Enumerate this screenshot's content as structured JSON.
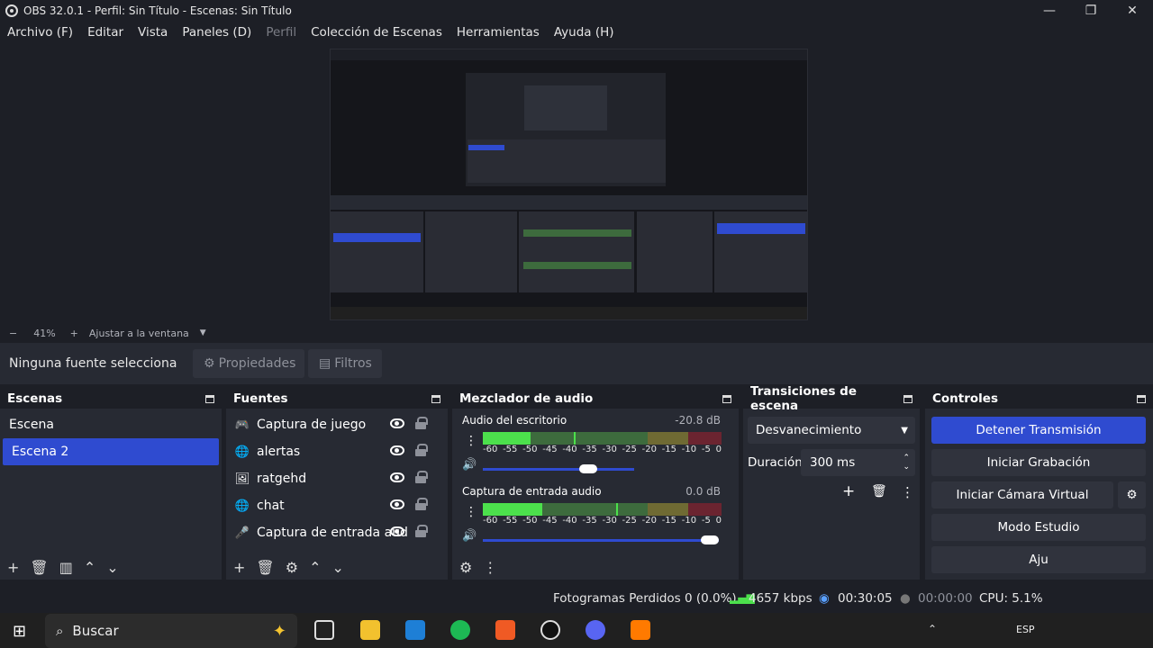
{
  "window": {
    "title": "OBS 32.0.1 - Perfil: Sin Título - Escenas: Sin Título",
    "controls": [
      "—",
      "❐",
      "✕"
    ]
  },
  "menu": [
    "Archivo (F)",
    "Editar",
    "Vista",
    "Paneles (D)",
    "Perfil",
    "Colección de Escenas",
    "Herramientas",
    "Ayuda (H)"
  ],
  "zoom": {
    "minus": "−",
    "value": "41%",
    "plus": "+",
    "fit_label": "Ajustar a la ventana"
  },
  "source_bar": {
    "no_source": "Ninguna fuente selecciona",
    "properties": "Propiedades",
    "filters": "Filtros"
  },
  "scenes": {
    "title": "Escenas",
    "items": [
      "Escena",
      "Escena 2"
    ],
    "selected_index": 1
  },
  "sources": {
    "title": "Fuentes",
    "items": [
      {
        "label": "Captura de juego",
        "icon": "gamepad-icon"
      },
      {
        "label": "alertas",
        "icon": "globe-icon"
      },
      {
        "label": "ratgehd",
        "icon": "image-icon"
      },
      {
        "label": "chat",
        "icon": "globe-icon"
      },
      {
        "label": "Captura de entrada aud",
        "icon": "microphone-icon"
      }
    ]
  },
  "mixer": {
    "title": "Mezclador de audio",
    "channels": [
      {
        "name": "Audio del escritorio",
        "db": "-20.8 dB",
        "level": 0.2,
        "peak": 0.38,
        "volume": 0.44
      },
      {
        "name": "Captura de entrada audio",
        "db": "0.0 dB",
        "level": 0.25,
        "peak": 0.56,
        "volume": 0.95
      }
    ],
    "ticks": [
      "-60",
      "-55",
      "-50",
      "-45",
      "-40",
      "-35",
      "-30",
      "-25",
      "-20",
      "-15",
      "-10",
      "-5",
      "0"
    ]
  },
  "transitions": {
    "title": "Transiciones de escena",
    "selected": "Desvanecimiento",
    "duration_label": "Duración",
    "duration_value": "300 ms"
  },
  "controls": {
    "title": "Controles",
    "stop_stream": "Detener Transmisión",
    "start_recording": "Iniciar Grabación",
    "start_virtual_cam": "Iniciar Cámara Virtual",
    "studio_mode": "Modo Estudio",
    "settings": "Aju"
  },
  "status": {
    "dropped_frames": "Fotogramas Perdidos 0 (0.0%)",
    "bitrate": "4657 kbps",
    "stream_time": "00:30:05",
    "record_time": "00:00:00",
    "cpu": "CPU: 5.1%"
  },
  "taskbar": {
    "search_placeholder": "Buscar",
    "lang": "ESP"
  },
  "colors": {
    "accent": "#2f4bd0",
    "background": "#1d1f26",
    "panel": "#272a33",
    "meter_green": "#4ce04c"
  }
}
